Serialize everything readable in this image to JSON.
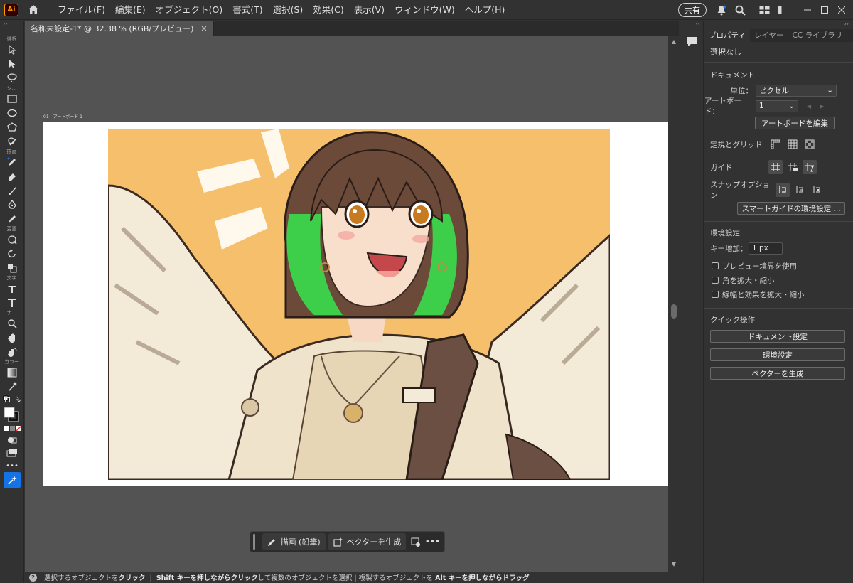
{
  "menubar": {
    "app_logo": "Ai",
    "items": [
      "ファイル(F)",
      "編集(E)",
      "オブジェクト(O)",
      "書式(T)",
      "選択(S)",
      "効果(C)",
      "表示(V)",
      "ウィンドウ(W)",
      "ヘルプ(H)"
    ],
    "share_label": "共有"
  },
  "toolbar": {
    "collapse": "››",
    "groups": {
      "select": "選択",
      "shape": "シ...",
      "draw": "描画",
      "transform": "変更",
      "type": "文字",
      "navigate": "ナ...",
      "color": "カラー"
    },
    "more": "•••"
  },
  "document": {
    "tab_title": "名称未設定-1* @ 32.38 % (RGB/プレビュー)",
    "artboard_label": "01 - アートボード 1"
  },
  "taskbar": {
    "draw_label": "描画 (鉛筆)",
    "vector_label": "ベクターを生成",
    "more": "•••"
  },
  "statusbar": {
    "help_icon": "?",
    "parts": [
      {
        "t": "選択するオブジェクトを",
        "b": false
      },
      {
        "t": "クリック",
        "b": true
      },
      {
        "t": "  |  ",
        "b": false
      },
      {
        "t": "Shift キーを押しながらクリック",
        "b": true
      },
      {
        "t": "して複数のオブジェクトを選択  |  複製するオブジェクトを ",
        "b": false
      },
      {
        "t": "Alt キーを押しながらドラッグ",
        "b": true
      }
    ]
  },
  "panel": {
    "collapse": "››",
    "tabs": [
      "プロパティ",
      "レイヤー",
      "CC ライブラリ"
    ],
    "selection": "選択なし",
    "document": {
      "title": "ドキュメント",
      "unit_label": "単位：",
      "unit_value": "ピクセル",
      "artboard_label": "アートボード：",
      "artboard_value": "1",
      "edit_artboard": "アートボードを編集"
    },
    "rulers_label": "定規とグリッド",
    "guides_label": "ガイド",
    "snap_label": "スナップオプション",
    "smart_guides": "スマートガイドの環境設定 ...",
    "preferences": {
      "title": "環境設定",
      "key_increment_label": "キー増加：",
      "key_increment_value": "1 px",
      "checks": [
        "プレビュー境界を使用",
        "角を拡大・縮小",
        "線幅と効果を拡大・縮小"
      ]
    },
    "quick_actions": {
      "title": "クイック操作",
      "buttons": [
        "ドキュメント設定",
        "環境設定",
        "ベクターを生成"
      ]
    }
  },
  "colors": {
    "accent": "#1473e6",
    "canvas": "#535353",
    "illustration_bg": "#f6bf6c",
    "hair": "#6b4a3a",
    "hair_highlight": "#3ecf4a"
  }
}
